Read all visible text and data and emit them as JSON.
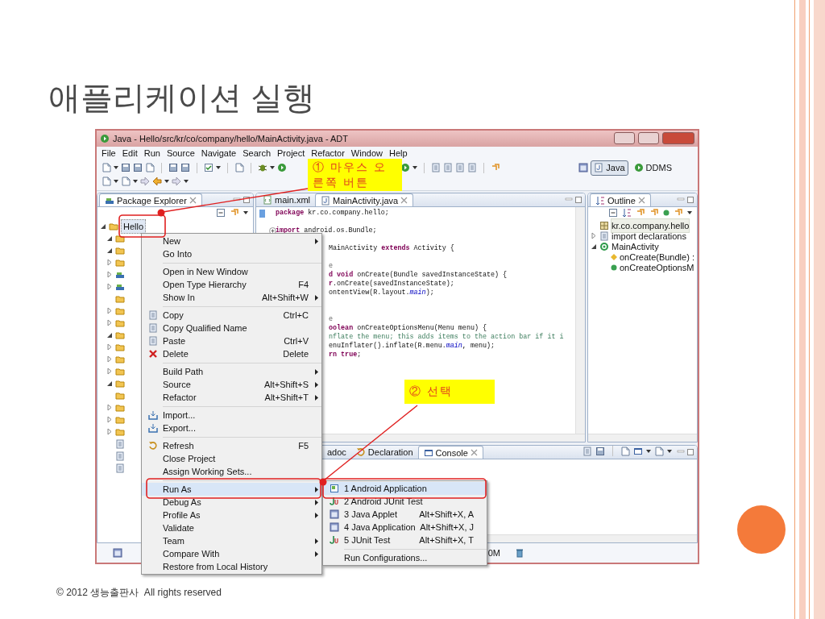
{
  "slide": {
    "title": "애플리케이션 실행",
    "footer": "© 2012 생능출판사  All rights reserved"
  },
  "window": {
    "title": "Java - Hello/src/kr/co/company/hello/MainActivity.java - ADT",
    "menu": [
      "File",
      "Edit",
      "Run",
      "Source",
      "Navigate",
      "Search",
      "Project",
      "Refactor",
      "Window",
      "Help"
    ],
    "perspectives": [
      {
        "label": "Java",
        "selected": true
      },
      {
        "label": "DDMS",
        "selected": false
      }
    ]
  },
  "package_explorer": {
    "tab": {
      "label": "Package Explorer",
      "selected": true
    },
    "tree": [
      {
        "label": "Hello",
        "selected": true,
        "expanded": true,
        "children": [
          {
            "kind": "folder",
            "expanded": true
          },
          {
            "kind": "folder",
            "expanded": true
          },
          {
            "kind": "folder",
            "expanded": false
          },
          {
            "kind": "library",
            "expanded": false
          },
          {
            "kind": "library",
            "expanded": false
          },
          {
            "kind": "folder"
          },
          {
            "kind": "folder",
            "expanded": false
          },
          {
            "kind": "folder",
            "expanded": false
          },
          {
            "kind": "folder",
            "expanded": true
          },
          {
            "kind": "folder",
            "expanded": false
          },
          {
            "kind": "folder",
            "expanded": false
          },
          {
            "kind": "folder",
            "expanded": false
          },
          {
            "kind": "folder",
            "expanded": true
          },
          {
            "kind": "folder"
          },
          {
            "kind": "folder",
            "expanded": false
          },
          {
            "kind": "folder",
            "expanded": false
          },
          {
            "kind": "folder",
            "expanded": false
          },
          {
            "kind": "file"
          },
          {
            "kind": "file"
          },
          {
            "kind": "file"
          }
        ]
      }
    ]
  },
  "editor": {
    "tabs": [
      {
        "label": "main.xml",
        "selected": false
      },
      {
        "label": "MainActivity.java",
        "selected": true
      }
    ],
    "lines": [
      {
        "kind": "code",
        "text": "**package** kr.co.company.hello;",
        "partial": false
      },
      {
        "kind": "blank"
      },
      {
        "kind": "code",
        "text": "**import** android.os.Bundle;",
        "partial": false,
        "folded": true
      },
      {
        "kind": "blank"
      },
      {
        "kind": "code",
        "text": "MainActivity **extends** Activity {",
        "partial": true
      },
      {
        "kind": "blank"
      },
      {
        "kind": "annotation",
        "text": "e",
        "partial": true
      },
      {
        "kind": "code",
        "text": "**d void** onCreate(Bundle savedInstanceState) {",
        "partial": true
      },
      {
        "kind": "code",
        "text": "**r**.onCreate(savedInstanceState);",
        "partial": true
      },
      {
        "kind": "code",
        "text": "ontentView(R.layout.*main*);",
        "partial": true
      },
      {
        "kind": "blank"
      },
      {
        "kind": "blank"
      },
      {
        "kind": "annotation",
        "text": "e",
        "partial": true
      },
      {
        "kind": "code",
        "text": "**oolean** onCreateOptionsMenu(Menu menu) {",
        "partial": true
      },
      {
        "kind": "comment",
        "text": "nflate the menu; this adds items to the action bar if it i",
        "partial": true
      },
      {
        "kind": "code",
        "text": "enuInflater().inflate(R.menu.*main*, menu);",
        "partial": true
      },
      {
        "kind": "code",
        "text": "**rn true**;",
        "partial": true
      }
    ]
  },
  "outline": {
    "tab": {
      "label": "Outline",
      "selected": true
    },
    "tree": [
      {
        "label": "kr.co.company.hello",
        "kind": "package",
        "selected": true
      },
      {
        "label": "import declarations",
        "kind": "imports",
        "selected": false,
        "expanded": false
      },
      {
        "label": "MainActivity",
        "kind": "class",
        "selected": false,
        "expanded": true,
        "children": [
          {
            "label": "onCreate(Bundle) :",
            "kind": "protected-method",
            "selected": false
          },
          {
            "label": "onCreateOptionsM",
            "kind": "public-method",
            "selected": false
          }
        ]
      }
    ]
  },
  "bottom_panel": {
    "tabs": [
      {
        "label": "adoc",
        "selected": false
      },
      {
        "label": "Declaration",
        "selected": false
      },
      {
        "label": "Console",
        "selected": true
      }
    ]
  },
  "status_bar": {
    "memory": "0M"
  },
  "context_menu": {
    "items": [
      {
        "kind": "item",
        "label": "New",
        "submenu": true,
        "selected": false
      },
      {
        "kind": "item",
        "label": "Go Into",
        "selected": false
      },
      {
        "kind": "separator"
      },
      {
        "kind": "item",
        "label": "Open in New Window",
        "selected": false
      },
      {
        "kind": "item",
        "label": "Open Type Hierarchy",
        "shortcut": "F4",
        "selected": false
      },
      {
        "kind": "item",
        "label": "Show In",
        "shortcut": "Alt+Shift+W",
        "submenu": true,
        "selected": false
      },
      {
        "kind": "separator"
      },
      {
        "kind": "item",
        "label": "Copy",
        "shortcut": "Ctrl+C",
        "icon": true,
        "selected": false
      },
      {
        "kind": "item",
        "label": "Copy Qualified Name",
        "icon": true,
        "selected": false
      },
      {
        "kind": "item",
        "label": "Paste",
        "shortcut": "Ctrl+V",
        "icon": true,
        "selected": false
      },
      {
        "kind": "item",
        "label": "Delete",
        "shortcut": "Delete",
        "icon": true,
        "selected": false
      },
      {
        "kind": "separator"
      },
      {
        "kind": "item",
        "label": "Build Path",
        "submenu": true,
        "selected": false
      },
      {
        "kind": "item",
        "label": "Source",
        "shortcut": "Alt+Shift+S",
        "submenu": true,
        "selected": false
      },
      {
        "kind": "item",
        "label": "Refactor",
        "shortcut": "Alt+Shift+T",
        "submenu": true,
        "selected": false
      },
      {
        "kind": "separator"
      },
      {
        "kind": "item",
        "label": "Import...",
        "icon": true,
        "selected": false
      },
      {
        "kind": "item",
        "label": "Export...",
        "icon": true,
        "selected": false
      },
      {
        "kind": "separator"
      },
      {
        "kind": "item",
        "label": "Refresh",
        "shortcut": "F5",
        "icon": true,
        "selected": false
      },
      {
        "kind": "item",
        "label": "Close Project",
        "selected": false
      },
      {
        "kind": "item",
        "label": "Assign Working Sets...",
        "selected": false
      },
      {
        "kind": "separator"
      },
      {
        "kind": "item",
        "label": "Run As",
        "submenu": true,
        "selected": true
      },
      {
        "kind": "item",
        "label": "Debug As",
        "submenu": true,
        "selected": false
      },
      {
        "kind": "item",
        "label": "Profile As",
        "submenu": true,
        "selected": false
      },
      {
        "kind": "item",
        "label": "Validate",
        "selected": false
      },
      {
        "kind": "item",
        "label": "Team",
        "submenu": true,
        "selected": false
      },
      {
        "kind": "item",
        "label": "Compare With",
        "submenu": true,
        "selected": false
      },
      {
        "kind": "item",
        "label": "Restore from Local History",
        "selected": false
      }
    ]
  },
  "submenu": {
    "items": [
      {
        "kind": "item",
        "label": "1 Android Application",
        "icon": true,
        "selected": true
      },
      {
        "kind": "item",
        "label": "2 Android JUnit Test",
        "icon": true,
        "selected": false
      },
      {
        "kind": "item",
        "label": "3 Java Applet",
        "shortcut": "Alt+Shift+X, A",
        "icon": true,
        "selected": false
      },
      {
        "kind": "item",
        "label": "4 Java Application",
        "shortcut": "Alt+Shift+X, J",
        "icon": true,
        "selected": false
      },
      {
        "kind": "item",
        "label": "5 JUnit Test",
        "shortcut": "Alt+Shift+X, T",
        "icon": true,
        "selected": false
      },
      {
        "kind": "separator"
      },
      {
        "kind": "item",
        "label": "Run Configurations...",
        "selected": false
      }
    ]
  },
  "callouts": [
    {
      "text": "① 마우스 오른쪽 버튼"
    },
    {
      "text": "② 선택"
    }
  ]
}
